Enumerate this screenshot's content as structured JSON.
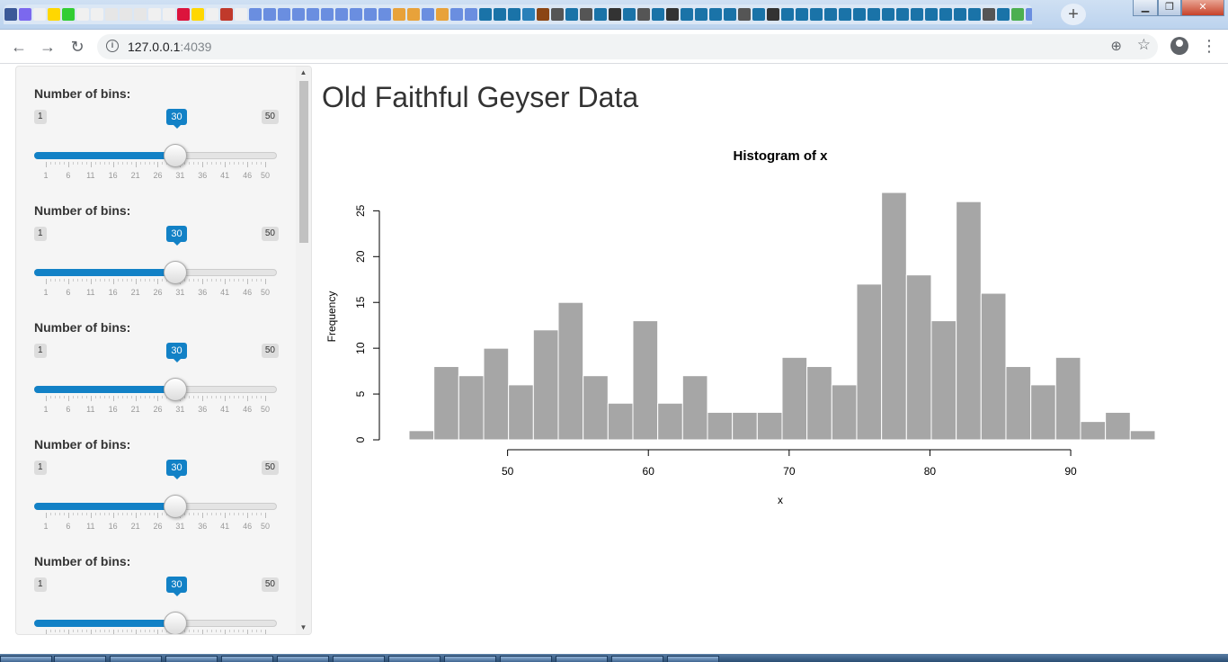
{
  "browser": {
    "url_host": "127.0.0.1",
    "url_port": ":4039",
    "tab_icon_colors": [
      "#3b5998",
      "#7b68ee",
      "#f0f0f0",
      "#ffd700",
      "#32cd32",
      "#f0f0f0",
      "#f0f0f0",
      "#e6e6e6",
      "#e6e6e6",
      "#e6e6e6",
      "#f0f0f0",
      "#f0f0f0",
      "#dc143c",
      "#ffd700",
      "#f0f0f0",
      "#c0392b",
      "#f0f0f0",
      "#6a8ee0",
      "#6a8ee0",
      "#6a8ee0",
      "#6a8ee0",
      "#6a8ee0",
      "#6a8ee0",
      "#6a8ee0",
      "#6a8ee0",
      "#6a8ee0",
      "#6a8ee0",
      "#e8a23a",
      "#e8a23a",
      "#6a8ee0",
      "#e8a23a",
      "#6a8ee0",
      "#6a8ee0",
      "#1a73a8",
      "#1a73a8",
      "#1a73a8",
      "#2980b9",
      "#8b4513",
      "#555",
      "#1a73a8",
      "#555",
      "#1a73a8",
      "#333",
      "#1a73a8",
      "#555",
      "#1a73a8",
      "#333",
      "#1a73a8",
      "#1a73a8",
      "#1a73a8",
      "#1a73a8",
      "#555",
      "#1a73a8",
      "#333",
      "#1a73a8",
      "#1a73a8",
      "#1a73a8",
      "#1a73a8",
      "#1a73a8",
      "#1a73a8",
      "#1a73a8",
      "#1a73a8",
      "#1a73a8",
      "#1a73a8",
      "#1a73a8",
      "#1a73a8",
      "#1a73a8",
      "#1a73a8",
      "#555",
      "#1a73a8",
      "#4caf50",
      "#6a8ee0",
      "#1a73a8",
      "#f0f0f0",
      "#f0f0f0",
      "#f0f0f0"
    ]
  },
  "page": {
    "title": "Old Faithful Geyser Data"
  },
  "sliders": [
    {
      "label": "Number of bins:",
      "min": 1,
      "max": 50,
      "value": 30
    },
    {
      "label": "Number of bins:",
      "min": 1,
      "max": 50,
      "value": 30
    },
    {
      "label": "Number of bins:",
      "min": 1,
      "max": 50,
      "value": 30
    },
    {
      "label": "Number of bins:",
      "min": 1,
      "max": 50,
      "value": 30
    },
    {
      "label": "Number of bins:",
      "min": 1,
      "max": 50,
      "value": 30
    }
  ],
  "slider_grid_labels": [
    "1",
    "6",
    "11",
    "16",
    "21",
    "26",
    "31",
    "36",
    "41",
    "46",
    "50"
  ],
  "chart_data": {
    "type": "bar",
    "title": "Histogram of x",
    "xlabel": "x",
    "ylabel": "Frequency",
    "bin_start": 43,
    "bin_width": 1.7666,
    "values": [
      1,
      8,
      7,
      10,
      6,
      12,
      15,
      7,
      4,
      13,
      4,
      7,
      3,
      3,
      3,
      9,
      8,
      6,
      17,
      27,
      18,
      13,
      26,
      16,
      8,
      6,
      9,
      2,
      3,
      1
    ],
    "xlim": [
      43,
      96
    ],
    "ylim": [
      0,
      27
    ],
    "x_ticks": [
      50,
      60,
      70,
      80,
      90
    ],
    "y_ticks": [
      0,
      5,
      10,
      15,
      20,
      25
    ],
    "bar_color": "#a6a6a6"
  }
}
